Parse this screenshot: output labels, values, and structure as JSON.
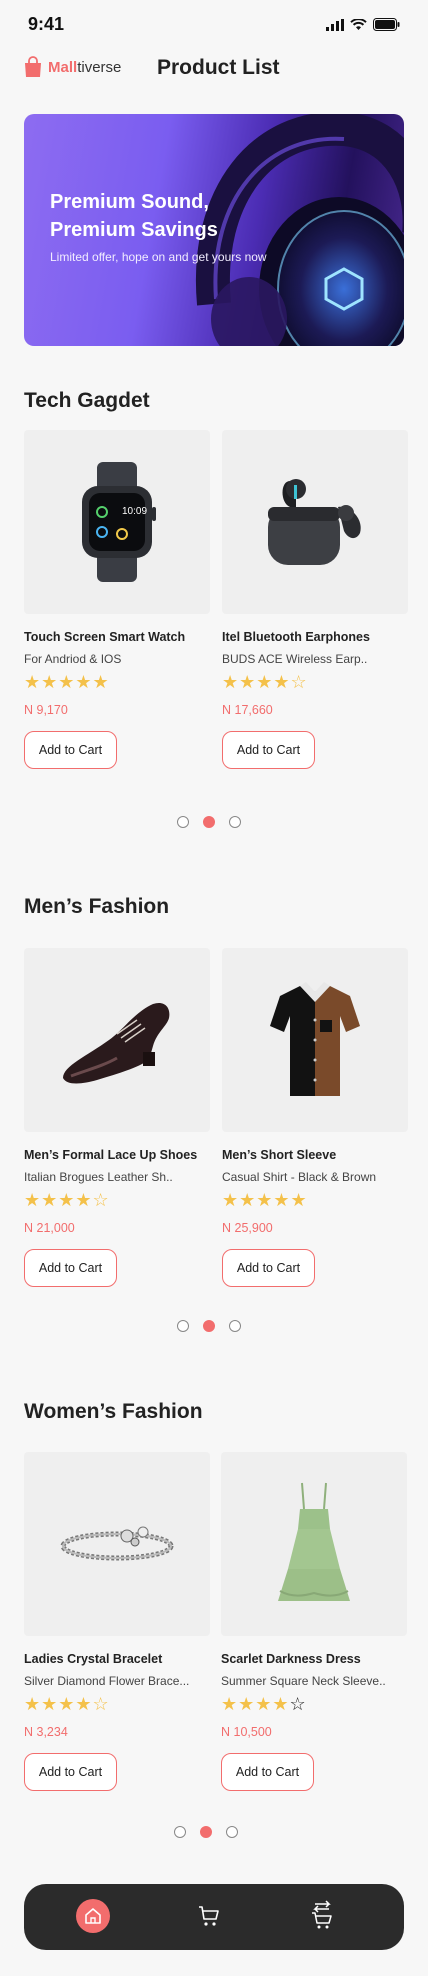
{
  "status": {
    "time": "9:41"
  },
  "header": {
    "brand_highlight": "Mall",
    "brand_rest": "tiverse",
    "title": "Product List"
  },
  "banner": {
    "title": "Premium Sound, Premium Savings",
    "subtitle": "Limited offer, hope on and get yours now"
  },
  "sections": [
    {
      "title": "Tech Gagdet",
      "products": [
        {
          "name": "Touch Screen Smart Watch",
          "desc": "For Andriod & IOS",
          "stars": "★★★★★",
          "price": "N 9,170",
          "button": "Add to Cart",
          "icon": "smartwatch-icon"
        },
        {
          "name": "Itel Bluetooth Earphones",
          "desc": "BUDS ACE Wireless Earp..",
          "stars": "★★★★☆",
          "price": "N 17,660",
          "button": "Add to Cart",
          "icon": "earbuds-icon"
        }
      ]
    },
    {
      "title": "Men’s Fashion",
      "products": [
        {
          "name": "Men’s Formal Lace Up Shoes",
          "desc": "Italian Brogues Leather Sh..",
          "stars": "★★★★☆",
          "price": "N 21,000",
          "button": "Add to Cart",
          "icon": "shoe-icon"
        },
        {
          "name": "Men’s Short Sleeve",
          "desc": "Casual Shirt - Black & Brown",
          "stars": "★★★★★",
          "price": "N 25,900",
          "button": "Add to Cart",
          "icon": "shirt-icon"
        }
      ]
    },
    {
      "title": "Women’s Fashion",
      "products": [
        {
          "name": "Ladies Crystal Bracelet",
          "desc": "Silver Diamond Flower Brace...",
          "stars": "★★★★☆",
          "price": "N 3,234",
          "button": "Add to Cart",
          "icon": "bracelet-icon"
        },
        {
          "name": "Scarlet Darkness Dress",
          "desc": "Summer Square Neck Sleeve..",
          "stars": "★★★★☆",
          "price": "N 10,500",
          "button": "Add to Cart",
          "icon": "dress-icon"
        }
      ]
    }
  ],
  "carousel": {
    "active_index": 1,
    "count": 3
  },
  "colors": {
    "accent": "#f26d6d",
    "star": "#f4c14a",
    "nav_bg": "#2b2b2b"
  },
  "bottom_nav": [
    "home-icon",
    "cart-icon",
    "swap-cart-icon"
  ]
}
